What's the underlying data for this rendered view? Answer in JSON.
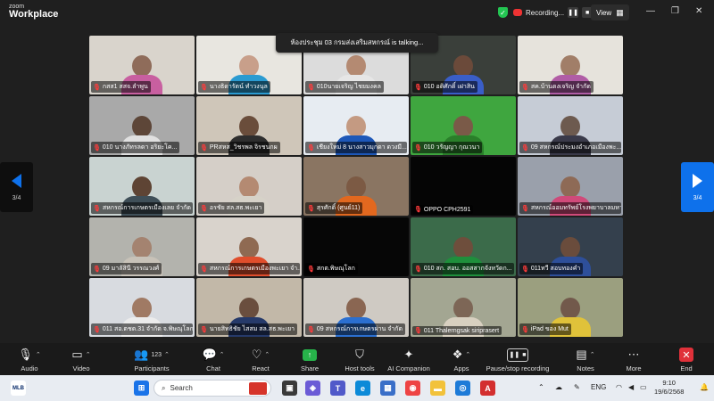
{
  "app": {
    "logo_top": "zoom",
    "logo_bottom": "Workplace"
  },
  "recording": {
    "label": "Recording...",
    "pause_icon": "pause-icon",
    "stop_icon": "stop-icon"
  },
  "view_button": {
    "label": "View"
  },
  "talking_banner": "ห้องประชุม 03 กรมส่งเสริมสหกรณ์ is talking...",
  "pager": {
    "left_page": "3/4",
    "right_page": "3/4"
  },
  "colors": {
    "accent": "#0e71eb",
    "share": "#27b24a",
    "end": "#e0313a",
    "mic_off": "#ff3b3b"
  },
  "participants": [
    {
      "name": "กสส1 สสจ.ลำพูน"
    },
    {
      "name": "นางธิดารัตน์ ทำวงนุล"
    },
    {
      "name": "010นายเจริญ ไชยมงคล"
    },
    {
      "name": "010 อดิศักดิ์ เฝาสิน"
    },
    {
      "name": "สค.บ้านดงเจริญ จำกัด"
    },
    {
      "name": "010 นางภัทรลดา อริยะโค..."
    },
    {
      "name": "PRสหส_วิชรพล จิรชนกผ"
    },
    {
      "name": "เชียงใหม่ 8 นางสาวมุกดา ดวงมี..."
    },
    {
      "name": "010 วรัญญา กุณวนา"
    },
    {
      "name": "09 สหกรณ์ประมงอำเภอเมืองพะ..."
    },
    {
      "name": "สหกรณ์การเกษตรเมืองเลย จำกัด"
    },
    {
      "name": "อรชัย สล.สธ.พะเยา"
    },
    {
      "name": "สุรศักดิ์ (ศูนย์11)"
    },
    {
      "name": "OPPO CPH2591"
    },
    {
      "name": "สหกรณ์ออมทรัพย์โรงพยาบาลมหาราช..."
    },
    {
      "name": "09 มาลัสินี วรรณวงศ์"
    },
    {
      "name": "สหกรณ์การเกษตรเมืองพะเยา จำ..."
    },
    {
      "name": "สกต.พิษณุโลก"
    },
    {
      "name": "010 สก. สอบ. ออสสากจังหวัดก..."
    },
    {
      "name": "011ทวี สอบทองคำ"
    },
    {
      "name": "011 สอ.ตชด.31 จำกัด จ.พิษณุโลก"
    },
    {
      "name": "นายสิทธิชัย ไสสม สล.สธ.พะเยา"
    },
    {
      "name": "09 สหกรณ์การเกษตรผ่าน จำกัด"
    },
    {
      "name": "011 Thalerngsak siriprasert"
    },
    {
      "name": "iPad ของ Mut"
    }
  ],
  "toolbar": {
    "audio": "Audio",
    "video": "Video",
    "participants": "Participants",
    "participants_count": "123",
    "chat": "Chat",
    "react": "React",
    "share": "Share",
    "host_tools": "Host tools",
    "ai_companion": "AI Companion",
    "apps": "Apps",
    "pause_recording": "Pause/stop recording",
    "notes": "Notes",
    "more": "More",
    "end": "End"
  },
  "taskbar": {
    "search_placeholder": "Search",
    "lang": "ENG",
    "time": "9:10",
    "date": "19/6/2568"
  }
}
